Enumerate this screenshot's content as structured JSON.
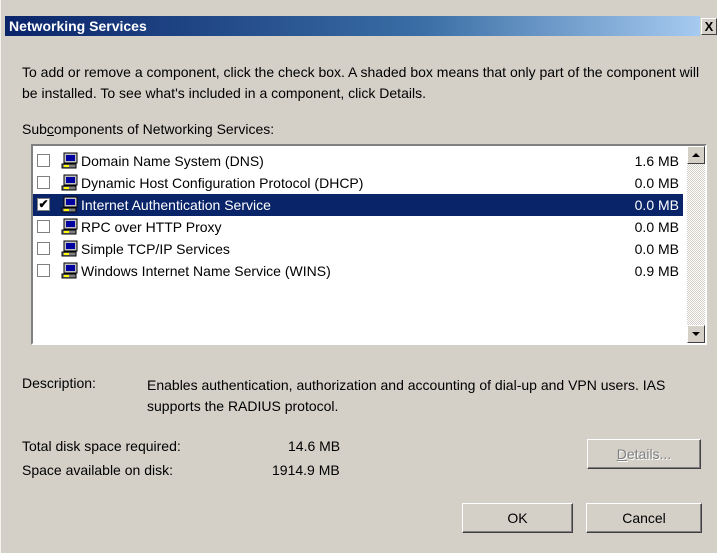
{
  "window": {
    "title": "Networking Services",
    "close_glyph": "X"
  },
  "intro_text": "To add or remove a component, click the check box. A shaded box means that only part of the component will be installed. To see what's included in a component, click Details.",
  "subcomponents_label": {
    "prefix": "Sub",
    "accel": "c",
    "suffix": "omponents of Networking Services:"
  },
  "components": [
    {
      "label": "Domain Name System (DNS)",
      "size": "1.6 MB",
      "checked": false,
      "selected": false
    },
    {
      "label": "Dynamic Host Configuration Protocol (DHCP)",
      "size": "0.0 MB",
      "checked": false,
      "selected": false
    },
    {
      "label": "Internet Authentication Service",
      "size": "0.0 MB",
      "checked": true,
      "selected": true
    },
    {
      "label": "RPC over HTTP Proxy",
      "size": "0.0 MB",
      "checked": false,
      "selected": false
    },
    {
      "label": "Simple TCP/IP Services",
      "size": "0.0 MB",
      "checked": false,
      "selected": false
    },
    {
      "label": "Windows Internet Name Service (WINS)",
      "size": "0.9 MB",
      "checked": false,
      "selected": false
    }
  ],
  "component_icon": "network-computer-icon",
  "description": {
    "label": "Description:",
    "text": "Enables authentication, authorization and accounting of dial-up and VPN users. IAS supports the RADIUS protocol."
  },
  "disk": {
    "required_label": "Total disk space required:",
    "required_value": "14.6 MB",
    "available_label": "Space available on disk:",
    "available_value": "1914.9 MB"
  },
  "buttons": {
    "details_accel": "D",
    "details_rest": "etails...",
    "ok": "OK",
    "cancel": "Cancel"
  },
  "colors": {
    "selection": "#0a246a",
    "face": "#d4d0c8"
  }
}
